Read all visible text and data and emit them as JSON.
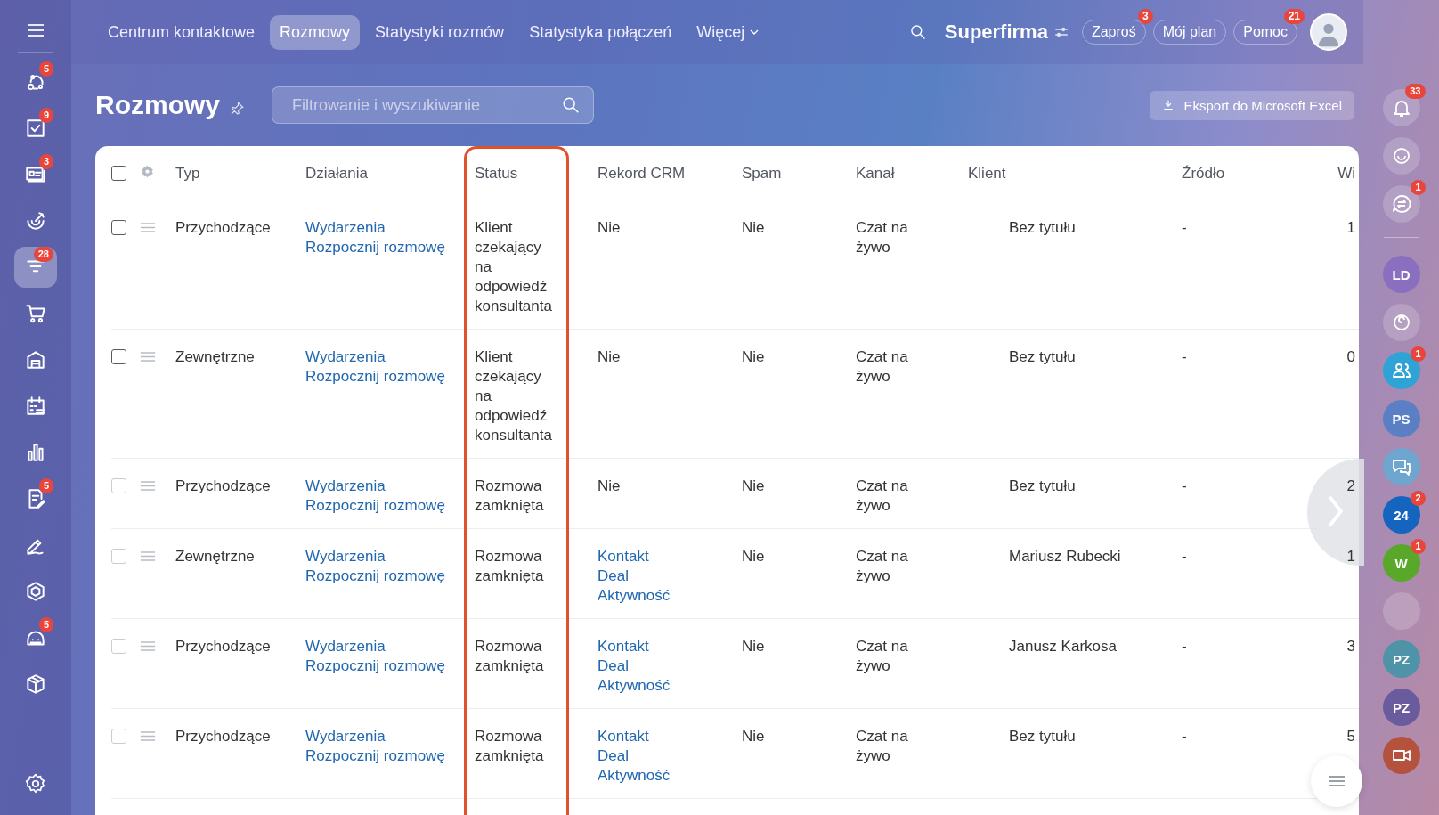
{
  "top_nav": {
    "tabs": [
      {
        "label": "Centrum kontaktowe",
        "selected": false
      },
      {
        "label": "Rozmowy",
        "selected": true
      },
      {
        "label": "Statystyki rozmów",
        "selected": false
      },
      {
        "label": "Statystyka połączeń",
        "selected": false
      },
      {
        "label": "Więcej",
        "selected": false,
        "has_menu": true
      }
    ],
    "company": "Superfirma",
    "buttons": [
      {
        "label": "Zaproś",
        "badge": "3"
      },
      {
        "label": "Mój plan"
      },
      {
        "label": "Pomoc",
        "badge": "21"
      }
    ]
  },
  "left_sidebar": {
    "items": [
      {
        "badge": "5",
        "selected": false
      },
      {
        "badge": "9",
        "selected": false
      },
      {
        "badge": "3",
        "selected": false
      },
      {
        "selected": false
      },
      {
        "badge": "28",
        "selected": true
      },
      {
        "selected": false
      },
      {
        "selected": false
      },
      {
        "selected": false
      },
      {
        "selected": false
      },
      {
        "badge": "5",
        "selected": false
      },
      {
        "selected": false
      },
      {
        "selected": false
      },
      {
        "badge": "5",
        "selected": false
      },
      {
        "selected": false
      }
    ]
  },
  "page": {
    "title": "Rozmowy",
    "search": {
      "placeholder": "Filtrowanie i wyszukiwanie"
    },
    "export_button": "Eksport do Microsoft Excel"
  },
  "table": {
    "select_all_checked": false,
    "columns": [
      "Typ",
      "Działania",
      "Status",
      "Rekord CRM",
      "Spam",
      "Kanał",
      "Klient",
      "Źródło",
      "Wi"
    ],
    "rows": [
      {
        "disabled": false,
        "typ": "Przychodzące",
        "dzialania": [
          "Wydarzenia",
          "Rozpocznij rozmowę"
        ],
        "status": "Klient czekający na odpowiedź konsultanta",
        "rekord_crm": "Nie",
        "spam": "Nie",
        "kanal": "Czat na żywo",
        "klient": "Bez tytułu",
        "zrodlo": "-",
        "column_9": "1"
      },
      {
        "disabled": false,
        "typ": "Zewnętrzne",
        "dzialania": [
          "Wydarzenia",
          "Rozpocznij rozmowę"
        ],
        "status": "Klient czekający na odpowiedź konsultanta",
        "rekord_crm": "Nie",
        "spam": "Nie",
        "kanal": "Czat na żywo",
        "klient": "Bez tytułu",
        "zrodlo": "-",
        "column_9": "0"
      },
      {
        "disabled": true,
        "typ": "Przychodzące",
        "dzialania": [
          "Wydarzenia",
          "Rozpocznij rozmowę"
        ],
        "status": "Rozmowa zamknięta",
        "rekord_crm": "Nie",
        "spam": "Nie",
        "kanal": "Czat na żywo",
        "klient": "Bez tytułu",
        "zrodlo": "-",
        "column_9": "2"
      },
      {
        "disabled": true,
        "typ": "Zewnętrzne",
        "dzialania": [
          "Wydarzenia",
          "Rozpocznij rozmowę"
        ],
        "status": "Rozmowa zamknięta",
        "rekord_crm_links": [
          "Kontakt",
          "Deal",
          "Aktywność"
        ],
        "spam": "Nie",
        "kanal": "Czat na żywo",
        "klient": "Mariusz Rubecki",
        "zrodlo": "-",
        "column_9": "1"
      },
      {
        "disabled": true,
        "typ": "Przychodzące",
        "dzialania": [
          "Wydarzenia",
          "Rozpocznij rozmowę"
        ],
        "status": "Rozmowa zamknięta",
        "rekord_crm_links": [
          "Kontakt",
          "Deal",
          "Aktywność"
        ],
        "spam": "Nie",
        "kanal": "Czat na żywo",
        "klient": "Janusz Karkosa",
        "zrodlo": "-",
        "column_9": "3"
      },
      {
        "disabled": true,
        "typ": "Przychodzące",
        "dzialania": [
          "Wydarzenia",
          "Rozpocznij rozmowę"
        ],
        "status": "Rozmowa zamknięta",
        "rekord_crm_links": [
          "Kontakt",
          "Deal",
          "Aktywność"
        ],
        "spam": "Nie",
        "kanal": "Czat na żywo",
        "klient": "Bez tytułu",
        "zrodlo": "-",
        "column_9": "5"
      }
    ]
  },
  "right_sidebar": {
    "items": [
      {
        "kind": "icon",
        "badge": "33"
      },
      {
        "kind": "icon"
      },
      {
        "kind": "icon",
        "badge": "1"
      },
      {
        "kind": "initials",
        "text": "LD",
        "color": "#8a6fc0"
      },
      {
        "kind": "icon"
      },
      {
        "kind": "icon",
        "badge": "1",
        "color": "#2fa3d6"
      },
      {
        "kind": "initials",
        "text": "PS",
        "color": "#5b7fc4"
      },
      {
        "kind": "icon",
        "color": "#6fa6d0"
      },
      {
        "kind": "initials",
        "text": "24",
        "badge": "2",
        "color": "#1565c0"
      },
      {
        "kind": "initials",
        "text": "W",
        "badge": "1",
        "color": "#5aa829"
      },
      {
        "kind": "photo"
      },
      {
        "kind": "initials",
        "text": "PZ",
        "color": "#4f93a8"
      },
      {
        "kind": "initials",
        "text": "PZ",
        "color": "#6a5a9e"
      },
      {
        "kind": "icon",
        "color": "#b5523e"
      }
    ]
  }
}
